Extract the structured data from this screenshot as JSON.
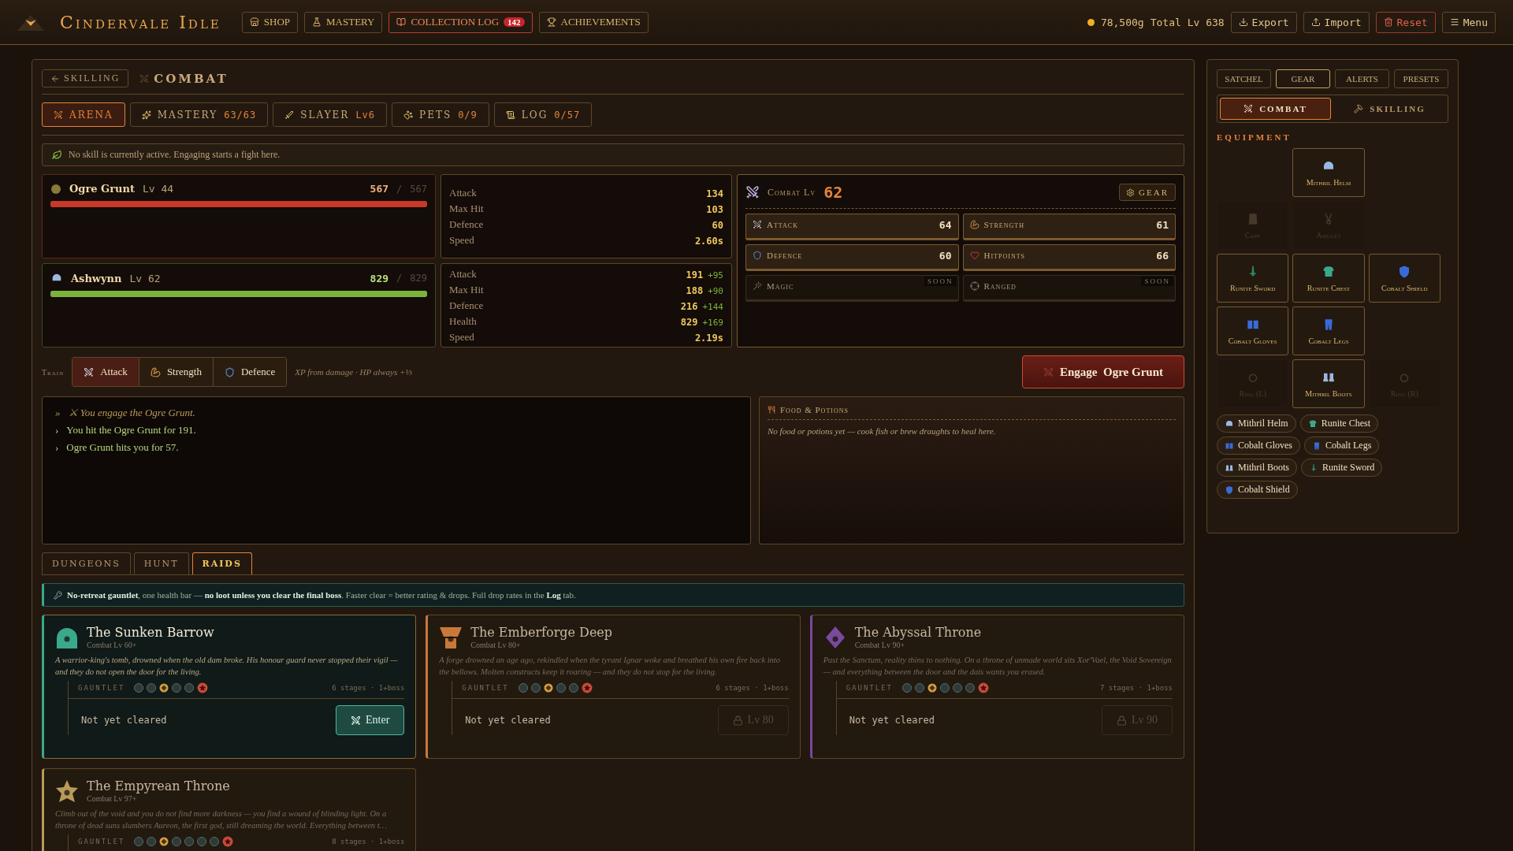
{
  "topbar": {
    "title": "Cindervale Idle",
    "nav": [
      {
        "label": "SHOP",
        "selected": false
      },
      {
        "label": "MASTERY",
        "selected": false
      },
      {
        "label": "COLLECTION LOG",
        "badge": "142",
        "selected": true
      },
      {
        "label": "ACHIEVEMENTS",
        "selected": false
      }
    ],
    "gold": "78,500g",
    "total_level": "Total Lv 638",
    "actions": [
      {
        "label": "Export",
        "kind": "normal"
      },
      {
        "label": "Import",
        "kind": "normal"
      },
      {
        "label": "Reset",
        "kind": "danger"
      },
      {
        "label": "Menu",
        "kind": "normal"
      }
    ]
  },
  "header": {
    "back": "SKILLING",
    "title": "COMBAT"
  },
  "subtabs": [
    {
      "label": "ARENA",
      "selected": true
    },
    {
      "label": "MASTERY",
      "count": "63/63",
      "selected": false
    },
    {
      "label": "SLAYER",
      "count": "Lv6",
      "selected": false
    },
    {
      "label": "PETS",
      "count": "0/9",
      "selected": false
    },
    {
      "label": "LOG",
      "count": "0/57",
      "selected": false
    }
  ],
  "notice": "No skill is currently active. Engaging starts a fight here.",
  "combatants": [
    {
      "name": "Ogre Grunt",
      "lv": "Lv 44",
      "hp": "567",
      "separator": "/",
      "max": "567",
      "level": 1,
      "color": "#c8392a",
      "stats": [
        {
          "label": "Attack",
          "value": "134"
        },
        {
          "label": "Max Hit",
          "value": "103"
        },
        {
          "label": "Defence",
          "value": "60"
        },
        {
          "label": "Speed",
          "value": "2.60s"
        }
      ]
    },
    {
      "name": "Ashwynn",
      "lv": "Lv 62",
      "hp": "829",
      "separator": "/",
      "max": "829",
      "level": 1,
      "color": "#7cb33a",
      "stats": [
        {
          "label": "Attack",
          "value": "191",
          "bonus": "+95"
        },
        {
          "label": "Max Hit",
          "value": "188",
          "bonus": "+90"
        },
        {
          "label": "Defence",
          "value": "216",
          "bonus": "+144"
        },
        {
          "label": "Health",
          "value": "829",
          "bonus": "+169"
        },
        {
          "label": "Speed",
          "value": "2.19s"
        }
      ]
    }
  ],
  "combat_level": {
    "label": "Combat Lv",
    "value": "62",
    "gear": "GEAR",
    "skills": [
      {
        "name": "Attack",
        "value": "64",
        "disabled": false
      },
      {
        "name": "Strength",
        "value": "61",
        "disabled": false
      },
      {
        "name": "Defence",
        "value": "60",
        "disabled": false
      },
      {
        "name": "Hitpoints",
        "value": "66",
        "disabled": false
      },
      {
        "name": "Magic",
        "badge": "SOON",
        "disabled": true
      },
      {
        "name": "Ranged",
        "badge": "SOON",
        "disabled": true
      }
    ]
  },
  "train": {
    "label": "Train",
    "options": [
      {
        "label": "Attack",
        "selected": true
      },
      {
        "label": "Strength",
        "selected": false
      },
      {
        "label": "Defence",
        "selected": false
      }
    ],
    "note": "XP from damage · HP always +⅓"
  },
  "engage": "Engage  Ogre Grunt",
  "log": [
    {
      "marker": "»",
      "text": "⚔ You engage the Ogre Grunt.",
      "kind": "info"
    },
    {
      "marker": "›",
      "text": "You hit the Ogre Grunt for 191.",
      "kind": "event"
    },
    {
      "marker": "›",
      "text": "Ogre Grunt hits you for 57.",
      "kind": "event"
    }
  ],
  "food": {
    "title": "Food & Potions",
    "text": "No food or potions yet — cook fish or brew draughts to heal here."
  },
  "modes": [
    {
      "label": "DUNGEONS",
      "selected": false
    },
    {
      "label": "HUNT",
      "selected": false
    },
    {
      "label": "RAIDS",
      "selected": true
    }
  ],
  "raid_info": "**No-retreat gauntlet**, one health bar — **no loot unless you clear the final boss**. Faster clear = better rating & drops. Full drop rates in the **Log** tab.",
  "raids": [
    {
      "name": "The Sunken Barrow",
      "req": "Combat Lv 60+",
      "color": "#3aa88a",
      "locked": false,
      "desc": "A warrior-king's tomb, drowned when the old dam broke. His honour guard never stopped their vigil — and they do not open the door for the living.",
      "gauntlet": "GAUNTLET",
      "dots": [
        {
          "kind": "stage"
        },
        {
          "kind": "stage"
        },
        {
          "kind": "current"
        },
        {
          "kind": "stage"
        },
        {
          "kind": "stage"
        },
        {
          "kind": "boss"
        }
      ],
      "stages": "6 stages · 1+boss",
      "status": "Not yet cleared",
      "action": "Enter"
    },
    {
      "name": "The Emberforge Deep",
      "req": "Combat Lv 80+",
      "color": "#c8783a",
      "locked": true,
      "desc": "A forge drowned an age ago, rekindled when the tyrant Ignar woke and breathed his own fire back into the bellows. Molten constructs keep it roaring — and they do not stop for the living.",
      "gauntlet": "GAUNTLET",
      "dots": [
        {
          "kind": "stage"
        },
        {
          "kind": "stage"
        },
        {
          "kind": "current"
        },
        {
          "kind": "stage"
        },
        {
          "kind": "stage"
        },
        {
          "kind": "boss"
        }
      ],
      "stages": "6 stages · 1+boss",
      "status": "Not yet cleared",
      "action": "Lv 80"
    },
    {
      "name": "The Abyssal Throne",
      "req": "Combat Lv 90+",
      "color": "#7a4a9a",
      "locked": true,
      "desc": "Past the Sanctum, reality thins to nothing. On a throne of unmade world sits Xor'Vael, the Void Sovereign — and everything between the door and the dais wants you erased.",
      "gauntlet": "GAUNTLET",
      "dots": [
        {
          "kind": "stage"
        },
        {
          "kind": "stage"
        },
        {
          "kind": "current"
        },
        {
          "kind": "stage"
        },
        {
          "kind": "stage"
        },
        {
          "kind": "stage"
        },
        {
          "kind": "boss"
        }
      ],
      "stages": "7 stages · 1+boss",
      "status": "Not yet cleared",
      "action": "Lv 90"
    },
    {
      "name": "The Empyrean Throne",
      "req": "Combat Lv 97+",
      "color": "#b89a5a",
      "locked": true,
      "desc": "Climb out of the void and you do not find more darkness — you find a wound of blinding light. On a throne of dead suns slumbers Aureon, the first god, still dreaming the world. Everything between t…",
      "gauntlet": "GAUNTLET",
      "dots": [
        {
          "kind": "stage"
        },
        {
          "kind": "stage"
        },
        {
          "kind": "current"
        },
        {
          "kind": "stage"
        },
        {
          "kind": "stage"
        },
        {
          "kind": "stage"
        },
        {
          "kind": "stage"
        },
        {
          "kind": "boss"
        }
      ],
      "stages": "8 stages · 1+boss"
    }
  ],
  "side": {
    "tabs": [
      {
        "label": "SATCHEL",
        "selected": false
      },
      {
        "label": "GEAR",
        "selected": true
      },
      {
        "label": "ALERTS",
        "selected": false
      },
      {
        "label": "PRESETS",
        "selected": false
      }
    ],
    "modes": [
      {
        "label": "COMBAT",
        "selected": true
      },
      {
        "label": "SKILLING",
        "selected": false
      }
    ],
    "heading": "EQUIPMENT",
    "slots": [
      [
        {
          "kind": "blank"
        },
        {
          "kind": "item",
          "name": "Mithril Helm",
          "color": "#9ab8e0"
        },
        {
          "kind": "blank"
        }
      ],
      [
        {
          "kind": "slot",
          "name": "Cape"
        },
        {
          "kind": "slot",
          "name": "Amulet"
        },
        {
          "kind": "blank"
        }
      ],
      [
        {
          "kind": "item",
          "name": "Runite Sword",
          "color": "#2e8a6a"
        },
        {
          "kind": "item",
          "name": "Runite Chest",
          "color": "#3aa88a"
        },
        {
          "kind": "item",
          "name": "Cobalt Shield",
          "color": "#3a6ad8"
        }
      ],
      [
        {
          "kind": "item",
          "name": "Cobalt Gloves",
          "color": "#3a6ad8"
        },
        {
          "kind": "item",
          "name": "Cobalt Legs",
          "color": "#3a6ad8"
        },
        {
          "kind": "blank"
        }
      ],
      [
        {
          "kind": "slot",
          "name": "Ring (L)"
        },
        {
          "kind": "item",
          "name": "Mithril Boots",
          "color": "#9ab8e0"
        },
        {
          "kind": "slot",
          "name": "Ring (R)"
        }
      ]
    ],
    "chips": [
      {
        "name": "Mithril Helm",
        "color": "#9ab8e0"
      },
      {
        "name": "Runite Chest",
        "color": "#3aa88a"
      },
      {
        "name": "Cobalt Gloves",
        "color": "#3a6ad8"
      },
      {
        "name": "Cobalt Legs",
        "color": "#3a6ad8"
      },
      {
        "name": "Mithril Boots",
        "color": "#9ab8e0"
      },
      {
        "name": "Runite Sword",
        "color": "#2e8a6a"
      },
      {
        "name": "Cobalt Shield",
        "color": "#3a6ad8"
      }
    ]
  }
}
